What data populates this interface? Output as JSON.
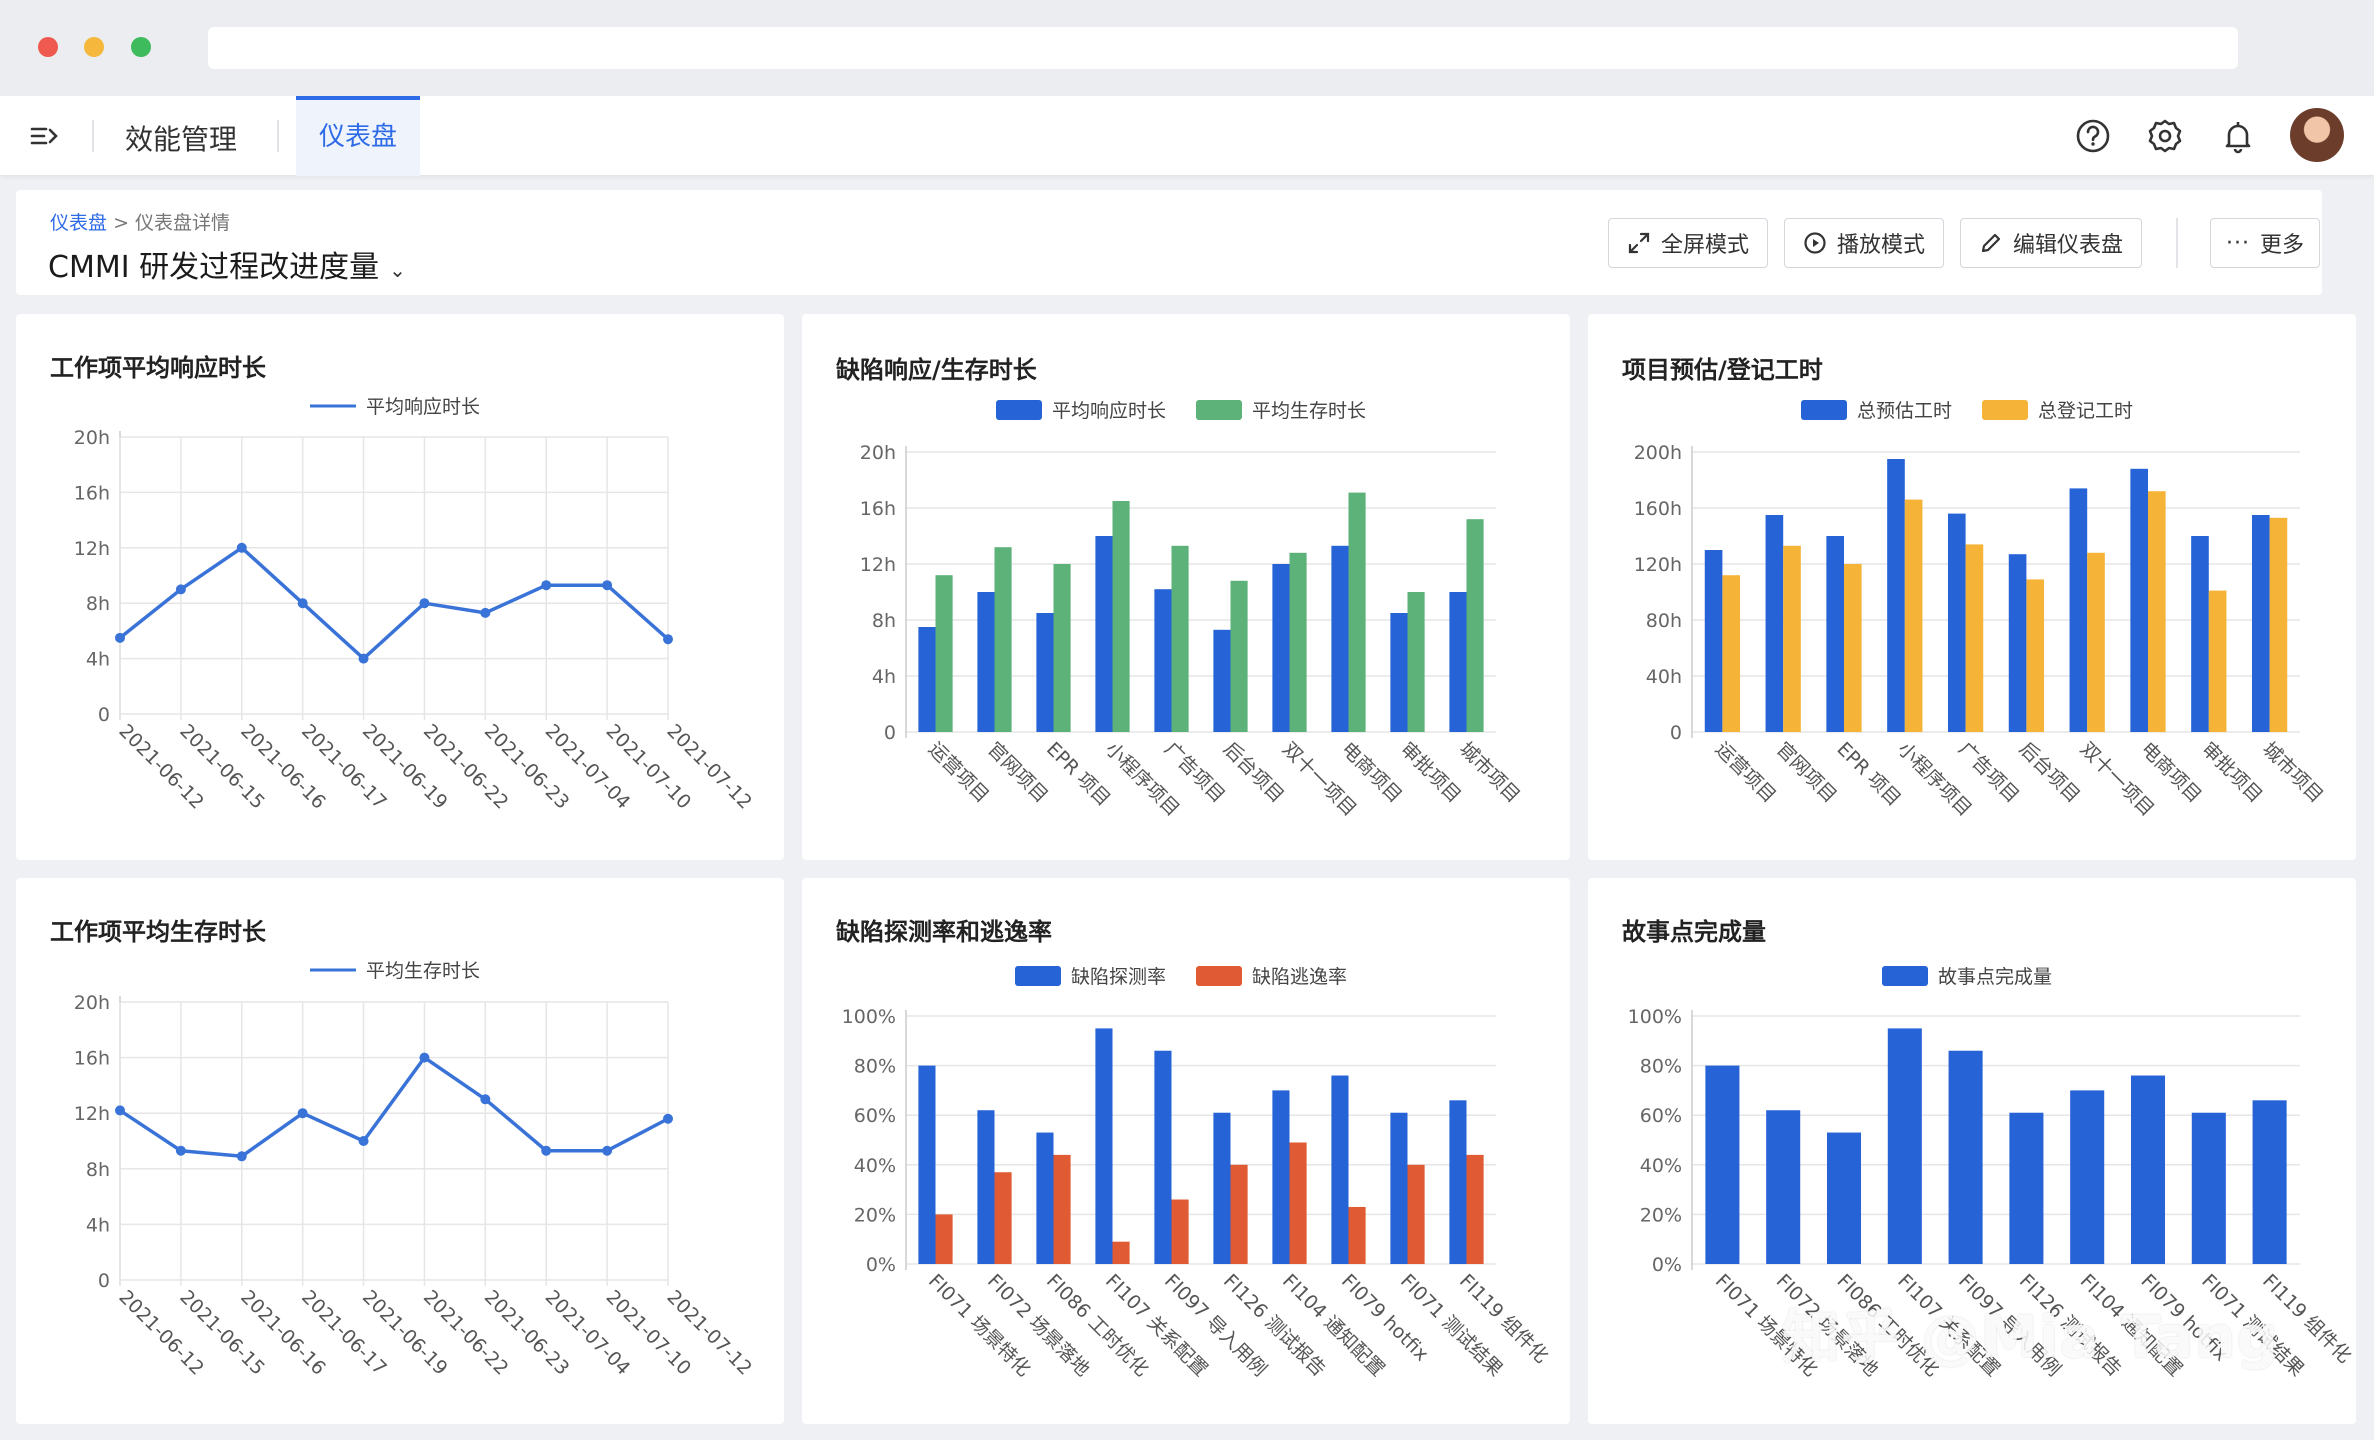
{
  "app": {
    "nav_title": "效能管理",
    "active_tab": "仪表盘"
  },
  "breadcrumb": {
    "root": "仪表盘",
    "separator": ">",
    "current": "仪表盘详情"
  },
  "page_title": "CMMI 研发过程改进度量",
  "toolbar": {
    "fullscreen_label": "全屏模式",
    "play_label": "播放模式",
    "edit_label": "编辑仪表盘",
    "more_label": "更多"
  },
  "colors": {
    "blue": "#2563d6",
    "line_blue": "#3a73d8",
    "green": "#5cb279",
    "orange": "#f5b338",
    "red": "#e05a33"
  },
  "watermark": "知乎 @Mia Tang",
  "chart_data": [
    {
      "id": "c1",
      "type": "line",
      "title": "工作项平均响应时长",
      "categories": [
        "2021-06-12",
        "2021-06-15",
        "2021-06-16",
        "2021-06-17",
        "2021-06-19",
        "2021-06-22",
        "2021-06-23",
        "2021-07-04",
        "2021-07-10",
        "2021-07-12"
      ],
      "series": [
        {
          "name": "平均响应时长",
          "values": [
            5.5,
            9,
            12,
            8,
            4,
            8,
            7.3,
            9.3,
            9.3,
            5.4
          ]
        }
      ],
      "yticks": [
        "0",
        "4h",
        "8h",
        "12h",
        "16h",
        "20h"
      ],
      "ylim": [
        0,
        20
      ]
    },
    {
      "id": "c2",
      "type": "bar",
      "title": "缺陷响应/生存时长",
      "categories": [
        "运营项目",
        "官网项目",
        "EPR 项目",
        "小程序项目",
        "广告项目",
        "后台项目",
        "双十一项目",
        "电商项目",
        "审批项目",
        "城市项目"
      ],
      "series": [
        {
          "name": "平均响应时长",
          "values": [
            7.5,
            10,
            8.5,
            14,
            10.2,
            7.3,
            12,
            13.3,
            8.5,
            10
          ]
        },
        {
          "name": "平均生存时长",
          "values": [
            11.2,
            13.2,
            12,
            16.5,
            13.3,
            10.8,
            12.8,
            17.1,
            10,
            15.2
          ]
        }
      ],
      "yticks": [
        "0",
        "4h",
        "8h",
        "12h",
        "16h",
        "20h"
      ],
      "ylim": [
        0,
        20
      ]
    },
    {
      "id": "c3",
      "type": "bar",
      "title": "项目预估/登记工时",
      "categories": [
        "运营项目",
        "官网项目",
        "EPR 项目",
        "小程序项目",
        "广告项目",
        "后台项目",
        "双十一项目",
        "电商项目",
        "审批项目",
        "城市项目"
      ],
      "series": [
        {
          "name": "总预估工时",
          "values": [
            130,
            155,
            140,
            195,
            156,
            127,
            174,
            188,
            140,
            155
          ]
        },
        {
          "name": "总登记工时",
          "values": [
            112,
            133,
            120,
            166,
            134,
            109,
            128,
            172,
            101,
            153
          ]
        }
      ],
      "yticks": [
        "0",
        "40h",
        "80h",
        "120h",
        "160h",
        "200h"
      ],
      "ylim": [
        0,
        200
      ]
    },
    {
      "id": "c4",
      "type": "line",
      "title": "工作项平均生存时长",
      "categories": [
        "2021-06-12",
        "2021-06-15",
        "2021-06-16",
        "2021-06-17",
        "2021-06-19",
        "2021-06-22",
        "2021-06-23",
        "2021-07-04",
        "2021-07-10",
        "2021-07-12"
      ],
      "series": [
        {
          "name": "平均生存时长",
          "values": [
            12.2,
            9.3,
            8.9,
            12,
            10,
            16,
            13,
            9.3,
            9.3,
            11.6
          ]
        }
      ],
      "yticks": [
        "0",
        "4h",
        "8h",
        "12h",
        "16h",
        "20h"
      ],
      "ylim": [
        0,
        20
      ]
    },
    {
      "id": "c5",
      "type": "bar",
      "title": "缺陷探测率和逃逸率",
      "categories": [
        "FI071 场景特化",
        "FI072 场景落地",
        "FI086 工时优化",
        "FI107 关系配置",
        "FI097 导入用例",
        "FI126 测试报告",
        "FI104 通知配置",
        "FI079 hotfix",
        "FI071 测试结果",
        "FI119 组件化"
      ],
      "series": [
        {
          "name": "缺陷探测率",
          "values": [
            80,
            62,
            53,
            95,
            86,
            61,
            70,
            76,
            61,
            66
          ]
        },
        {
          "name": "缺陷逃逸率",
          "values": [
            20,
            37,
            44,
            9,
            26,
            40,
            49,
            23,
            40,
            44
          ]
        }
      ],
      "yticks": [
        "0%",
        "20%",
        "40%",
        "60%",
        "80%",
        "100%"
      ],
      "ylim": [
        0,
        100
      ]
    },
    {
      "id": "c6",
      "type": "bar",
      "title": "故事点完成量",
      "categories": [
        "FI071 场景特化",
        "FI072 场景落地",
        "FI086 工时优化",
        "FI107 关系配置",
        "FI097 导入用例",
        "FI126 测试报告",
        "FI104 通知配置",
        "FI079 hotfix",
        "FI071 测试结果",
        "FI119 组件化"
      ],
      "series": [
        {
          "name": "故事点完成量",
          "values": [
            80,
            62,
            53,
            95,
            86,
            61,
            70,
            76,
            61,
            66
          ]
        }
      ],
      "yticks": [
        "0%",
        "20%",
        "40%",
        "60%",
        "80%",
        "100%"
      ],
      "ylim": [
        0,
        100
      ]
    }
  ]
}
